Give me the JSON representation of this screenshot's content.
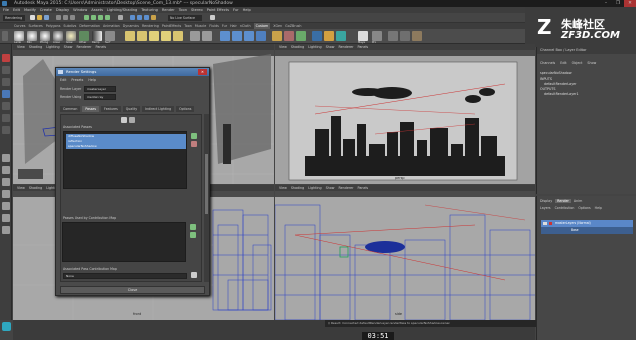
{
  "window": {
    "title": "Autodesk Maya 2015: C:\\Users\\Administrator\\Desktop\\Scene_Com_13.mb* --- specularNoShadow",
    "controls": [
      "–",
      "❐",
      "✕"
    ]
  },
  "menubar": [
    "File",
    "Edit",
    "Modify",
    "Create",
    "Display",
    "Window",
    "Assets",
    "Lighting/Shading",
    "Texturing",
    "Render",
    "Toon",
    "Stereo",
    "Paint Effects",
    "Fur",
    "Help"
  ],
  "statusline": {
    "mode": "Rendering",
    "surface": "No Live Surface"
  },
  "shelf": {
    "tabs": [
      "Curves",
      "Surfaces",
      "Polygons",
      "Subdivs",
      "Deformation",
      "Animation",
      "Dynamics",
      "Rendering",
      "PaintEffects",
      "Toon",
      "Muscle",
      "Fluids",
      "Fur",
      "Hair",
      "nCloth",
      "Custom",
      "XGen",
      "GoZBrush"
    ],
    "active_tab": "Custom",
    "labels": [
      "Lamb",
      "Blin",
      "Phong",
      "Aniso",
      "Glow",
      "Other",
      "Ramp",
      "Surf"
    ],
    "right_labels": [
      "Maya",
      "Prx"
    ]
  },
  "logo": {
    "mark": "Z",
    "cn": "朱峰社区",
    "domain": "ZF3D.COM"
  },
  "viewports": {
    "menu": [
      "View",
      "Shading",
      "Lighting",
      "Show",
      "Renderer",
      "Panels"
    ],
    "top_left_label": "top",
    "top_right_label": "persp",
    "bottom_left_label": "front",
    "bottom_right_label": "side"
  },
  "channel_box": {
    "header": "Channel Box / Layer Editor",
    "menu": [
      "Channels",
      "Edit",
      "Object",
      "Show"
    ],
    "node": "specularNoShadow",
    "inputs_label": "INPUTS",
    "inputs_item": "defaultRenderLayer",
    "outputs_label": "OUTPUTS",
    "outputs_item": "defaultRenderLayer1"
  },
  "layer_editor": {
    "tabs": [
      "Display",
      "Render",
      "Anim"
    ],
    "active_tab": "Render",
    "menu": [
      "Layers",
      "Contribution",
      "Options",
      "Help"
    ],
    "layer_name": "masterLayers (Normal)",
    "master_label": "Base"
  },
  "render_settings": {
    "title": "Render Settings",
    "menu": [
      "Edit",
      "Presets",
      "Help"
    ],
    "render_layer_label": "Render Layer",
    "render_layer_value": "masterLayer",
    "render_using_label": "Render Using",
    "render_using_value": "mental ray",
    "tabs": [
      "Common",
      "Passes",
      "Features",
      "Quality",
      "Indirect Lighting",
      "Options"
    ],
    "active_tab": "Passes",
    "total_passes_label": "Total Passes",
    "associated_label": "Associated Passes",
    "associated_items": [
      "diffuseNoShadow",
      "reflection",
      "specularNoShadow"
    ],
    "contribution_label": "Associated Pass Contribution Map",
    "contribution_value": "None",
    "passes_used_label": "Passes Used by Contribution Map",
    "close_label": "Close"
  },
  "command_line": "// Result: Connected defaultRenderLayer.renderPass to specularNoShadow.owner.",
  "timecode": "03:51"
}
